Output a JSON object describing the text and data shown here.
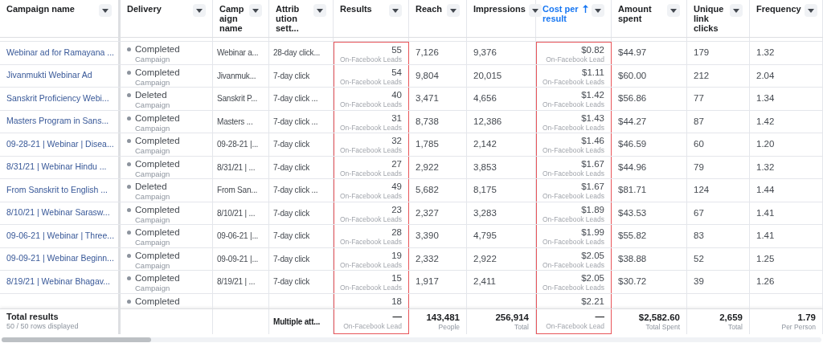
{
  "columns": [
    {
      "label": "Campaign name",
      "highlighted": false,
      "sorted": false
    },
    {
      "label": "Delivery",
      "highlighted": false,
      "sorted": false
    },
    {
      "label": "Camp aign name",
      "highlighted": false,
      "sorted": false
    },
    {
      "label": "Attrib ution sett...",
      "highlighted": false,
      "sorted": false
    },
    {
      "label": "Results",
      "highlighted": true,
      "sorted": false
    },
    {
      "label": "Reach",
      "highlighted": false,
      "sorted": false
    },
    {
      "label": "Impressions",
      "highlighted": false,
      "sorted": false
    },
    {
      "label": "Cost per result",
      "highlighted": true,
      "sorted": true
    },
    {
      "label": "Amount spent",
      "highlighted": false,
      "sorted": false
    },
    {
      "label": "Unique link clicks",
      "highlighted": false,
      "sorted": false
    },
    {
      "label": "Frequency",
      "highlighted": false,
      "sorted": false
    }
  ],
  "rows": [
    {
      "name": "Webinar ad for Ramayana ...",
      "delivery": "Completed",
      "delivery_type": "Campaign",
      "campaign": "Webinar a...",
      "attribution": "28-day click...",
      "results": "55",
      "results_type": "On-Facebook Leads",
      "reach": "7,126",
      "impressions": "9,376",
      "cost": "$0.82",
      "cost_type": "On-Facebook Lead",
      "spent": "$44.97",
      "clicks": "179",
      "frequency": "1.32"
    },
    {
      "name": "Jivanmukti Webinar Ad",
      "delivery": "Completed",
      "delivery_type": "Campaign",
      "campaign": "Jivanmuk...",
      "attribution": "7-day click",
      "results": "54",
      "results_type": "On-Facebook Leads",
      "reach": "9,804",
      "impressions": "20,015",
      "cost": "$1.11",
      "cost_type": "On-Facebook Leads",
      "spent": "$60.00",
      "clicks": "212",
      "frequency": "2.04"
    },
    {
      "name": "Sanskrit Proficiency Webi...",
      "delivery": "Deleted",
      "delivery_type": "Campaign",
      "campaign": "Sanskrit P...",
      "attribution": "7-day click ...",
      "results": "40",
      "results_type": "On-Facebook Leads",
      "reach": "3,471",
      "impressions": "4,656",
      "cost": "$1.42",
      "cost_type": "On-Facebook Leads",
      "spent": "$56.86",
      "clicks": "77",
      "frequency": "1.34"
    },
    {
      "name": "Masters Program in Sans...",
      "delivery": "Completed",
      "delivery_type": "Campaign",
      "campaign": "Masters ...",
      "attribution": "7-day click ...",
      "results": "31",
      "results_type": "On-Facebook Leads",
      "reach": "8,738",
      "impressions": "12,386",
      "cost": "$1.43",
      "cost_type": "On-Facebook Leads",
      "spent": "$44.27",
      "clicks": "87",
      "frequency": "1.42"
    },
    {
      "name": "09-28-21 | Webinar | Disea...",
      "delivery": "Completed",
      "delivery_type": "Campaign",
      "campaign": "09-28-21 |...",
      "attribution": "7-day click",
      "results": "32",
      "results_type": "On-Facebook Leads",
      "reach": "1,785",
      "impressions": "2,142",
      "cost": "$1.46",
      "cost_type": "On-Facebook Leads",
      "spent": "$46.59",
      "clicks": "60",
      "frequency": "1.20"
    },
    {
      "name": "8/31/21 | Webinar Hindu ...",
      "delivery": "Completed",
      "delivery_type": "Campaign",
      "campaign": "8/31/21 | ...",
      "attribution": "7-day click",
      "results": "27",
      "results_type": "On-Facebook Leads",
      "reach": "2,922",
      "impressions": "3,853",
      "cost": "$1.67",
      "cost_type": "On-Facebook Leads",
      "spent": "$44.96",
      "clicks": "79",
      "frequency": "1.32"
    },
    {
      "name": "From Sanskrit to English ...",
      "delivery": "Deleted",
      "delivery_type": "Campaign",
      "campaign": "From San...",
      "attribution": "7-day click ...",
      "results": "49",
      "results_type": "On-Facebook Leads",
      "reach": "5,682",
      "impressions": "8,175",
      "cost": "$1.67",
      "cost_type": "On-Facebook Leads",
      "spent": "$81.71",
      "clicks": "124",
      "frequency": "1.44"
    },
    {
      "name": "8/10/21 | Webinar Sarasw...",
      "delivery": "Completed",
      "delivery_type": "Campaign",
      "campaign": "8/10/21 | ...",
      "attribution": "7-day click",
      "results": "23",
      "results_type": "On-Facebook Leads",
      "reach": "2,327",
      "impressions": "3,283",
      "cost": "$1.89",
      "cost_type": "On-Facebook Leads",
      "spent": "$43.53",
      "clicks": "67",
      "frequency": "1.41"
    },
    {
      "name": "09-06-21 | Webinar | Three...",
      "delivery": "Completed",
      "delivery_type": "Campaign",
      "campaign": "09-06-21 |...",
      "attribution": "7-day click",
      "results": "28",
      "results_type": "On-Facebook Leads",
      "reach": "3,390",
      "impressions": "4,795",
      "cost": "$1.99",
      "cost_type": "On-Facebook Leads",
      "spent": "$55.82",
      "clicks": "83",
      "frequency": "1.41"
    },
    {
      "name": "09-09-21 | Webinar Beginn...",
      "delivery": "Completed",
      "delivery_type": "Campaign",
      "campaign": "09-09-21 |...",
      "attribution": "7-day click",
      "results": "19",
      "results_type": "On-Facebook Leads",
      "reach": "2,332",
      "impressions": "2,922",
      "cost": "$2.05",
      "cost_type": "On-Facebook Leads",
      "spent": "$38.88",
      "clicks": "52",
      "frequency": "1.25"
    },
    {
      "name": "8/19/21 | Webinar Bhagav...",
      "delivery": "Completed",
      "delivery_type": "Campaign",
      "campaign": "8/19/21 | ...",
      "attribution": "7-day click",
      "results": "15",
      "results_type": "On-Facebook Leads",
      "reach": "1,917",
      "impressions": "2,411",
      "cost": "$2.05",
      "cost_type": "On-Facebook Leads",
      "spent": "$30.72",
      "clicks": "39",
      "frequency": "1.26"
    },
    {
      "delivery": "Completed",
      "results": "18",
      "cost": "$2.21"
    }
  ],
  "footer": {
    "title": "Total results",
    "subtitle": "50 / 50 rows displayed",
    "attribution": "Multiple att...",
    "results": "—",
    "results_type": "On-Facebook Lead",
    "reach": "143,481",
    "reach_unit": "People",
    "impressions": "256,914",
    "impressions_unit": "Total",
    "cost": "—",
    "cost_type": "On-Facebook Lead",
    "spent": "$2,582.60",
    "spent_unit": "Total Spent",
    "clicks": "2,659",
    "clicks_unit": "Total",
    "frequency": "1.79",
    "frequency_unit": "Per Person"
  }
}
